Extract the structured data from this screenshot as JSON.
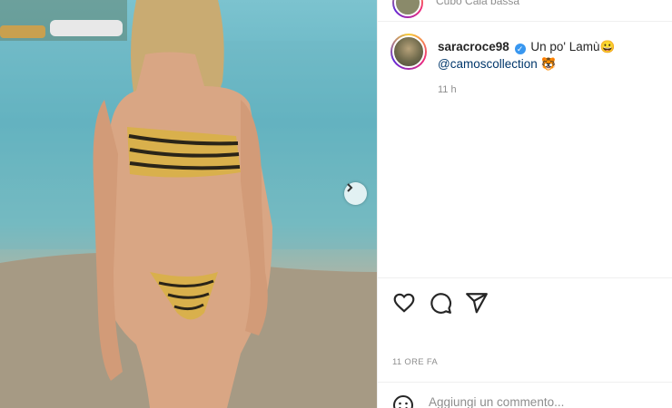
{
  "post": {
    "location": "Cubo Cala bassa",
    "photo_alt": "photo",
    "next_icon": "chevron-right-icon"
  },
  "caption": {
    "username": "saracroce98",
    "verified_icon": "verified-badge-icon",
    "text": "Un po' Lamù😀",
    "mention": "@camoscollection",
    "emoji_after_mention": "🐯",
    "relative_time": "11 h"
  },
  "actions": {
    "like_icon": "heart-icon",
    "comment_icon": "comment-icon",
    "share_icon": "share-icon"
  },
  "footer": {
    "date_label": "11 ORE FA",
    "comment_placeholder": "Aggiungi un commento...",
    "emoji_icon": "emoji-icon"
  }
}
